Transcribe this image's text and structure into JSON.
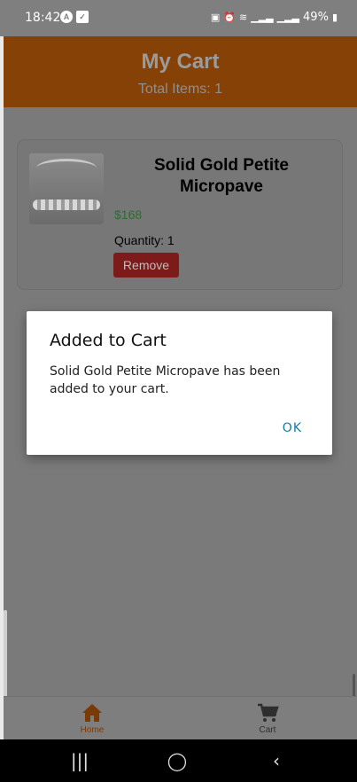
{
  "status_bar": {
    "time": "18:42",
    "battery": "49%",
    "left_icons": [
      "a-circle-icon",
      "check-square-icon"
    ],
    "right_icons": [
      "lock-icon",
      "alarm-icon",
      "wifi-icon",
      "signal-icon",
      "signal-icon",
      "battery-icon"
    ]
  },
  "header": {
    "title": "My Cart",
    "subtitle": "Total Items: 1",
    "color": "#d9730d"
  },
  "cart": {
    "items": [
      {
        "name": "Solid Gold Petite Micropave",
        "price": "$168",
        "quantity": "Quantity: 1",
        "remove_label": "Remove",
        "image_icon": "ring-product-image"
      }
    ]
  },
  "dialog": {
    "title": "Added to Cart",
    "message": "Solid Gold Petite Micropave  has been added to your cart.",
    "ok_label": "OK",
    "ok_color": "#137aa7"
  },
  "tabs": [
    {
      "label": "Home",
      "icon": "home-icon",
      "active": true
    },
    {
      "label": "Cart",
      "icon": "cart-icon",
      "active": false
    }
  ],
  "nav": {
    "recent_glyph": "|||",
    "home_glyph": "◯",
    "back_glyph": "‹"
  }
}
